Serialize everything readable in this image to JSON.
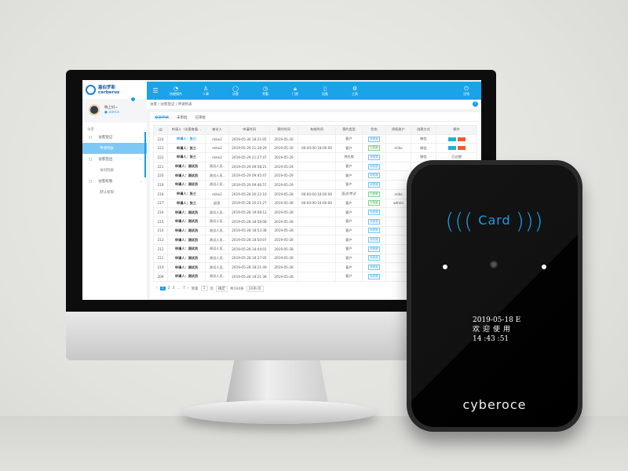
{
  "app": {
    "logo_cn": "塞伯罗斯",
    "logo_en": "cerberus"
  },
  "user": {
    "greeting": "晚上好~",
    "role": "admin"
  },
  "sidebar": {
    "group": "访客",
    "items": [
      {
        "label": "访客登记",
        "icon": "register-icon",
        "children": [
          {
            "label": "申请列表",
            "active": true
          }
        ]
      },
      {
        "label": "访客签出",
        "icon": "person-icon",
        "children": [
          {
            "label": "访问列表"
          }
        ]
      },
      {
        "label": "访客权限",
        "icon": "lock-icon",
        "children": [
          {
            "label": "默认权限"
          }
        ]
      }
    ]
  },
  "topnav": [
    {
      "label": "快捷操作",
      "icon": "dashboard-icon"
    },
    {
      "label": "人事",
      "icon": "person-icon"
    },
    {
      "label": "访客",
      "icon": "visitor-icon"
    },
    {
      "label": "考勤",
      "icon": "clock-icon"
    },
    {
      "label": "门禁",
      "icon": "lock-icon"
    },
    {
      "label": "设备",
      "icon": "device-icon"
    },
    {
      "label": "工具",
      "icon": "gear-icon"
    }
  ],
  "logout": "注销",
  "breadcrumb": [
    "访客",
    "访客登记",
    "申请列表"
  ],
  "tabs": [
    "全部申请",
    "未审批",
    "已审批"
  ],
  "table": {
    "headers": [
      "ID",
      "申请人（访客查看…",
      "被访人",
      "申请时间",
      "预约时间",
      "有效时间",
      "预约类型",
      "状态",
      "授权账户",
      "创建方式",
      "操作"
    ],
    "rows": [
      [
        "224",
        "申请人：张三",
        "mike2",
        "2019-05-30 18:21:05",
        "2019-05-30",
        "",
        "客户",
        "待批准",
        "",
        "微信",
        "actions"
      ],
      [
        "223",
        "申请人：张三",
        "mike2",
        "2019-05-29 21:28:29",
        "2019-05-30",
        "06:00:00-18:00:00",
        "客户",
        "已批准",
        "mike",
        "微信",
        "actions"
      ],
      [
        "222",
        "申请人：张三",
        "mike2",
        "2019-05-29 21:27:47",
        "2019-05-29",
        "",
        "供应商",
        "待批准",
        "",
        "微信",
        "已过期"
      ],
      [
        "221",
        "申请人：测试员",
        "测试人员..",
        "2019-05-29 09:58:21",
        "2019-05-29",
        "",
        "客户",
        "待批准",
        "",
        "",
        ""
      ],
      [
        "220",
        "申请人：测试员",
        "测试人员..",
        "2019-05-29 09:45:47",
        "2019-05-29",
        "",
        "客户",
        "待批准",
        "",
        "",
        ""
      ],
      [
        "219",
        "申请人：测试员",
        "测试人员..",
        "2019-05-29 09:46:57",
        "2019-05-29",
        "",
        "客户",
        "待批准",
        "",
        "",
        ""
      ],
      [
        "218",
        "申请人：张三",
        "mike2",
        "2019-05-28 20:22:10",
        "2019-05-28",
        "06:00:00-18:00:00",
        "面试/考试",
        "已批准",
        "mike",
        "",
        ""
      ],
      [
        "217",
        "申请人：张三",
        "赵凯",
        "2019-05-28 20:21:27",
        "2019-05-28",
        "06:00:00-18:00:00",
        "客户",
        "已批准",
        "admin",
        "",
        ""
      ],
      [
        "216",
        "申请人：测试员",
        "测试人员..",
        "2019-05-28 19:08:12",
        "2019-05-28",
        "",
        "客户",
        "待批准",
        "",
        "",
        ""
      ],
      [
        "215",
        "申请人：测试员",
        "测试人员..",
        "2019-05-28 18:59:08",
        "2019-05-28",
        "",
        "客户",
        "待批准",
        "",
        "",
        ""
      ],
      [
        "214",
        "申请人：测试员",
        "测试人员..",
        "2019-05-28 18:53:38",
        "2019-05-28",
        "",
        "客户",
        "待批准",
        "",
        "",
        ""
      ],
      [
        "213",
        "申请人：测试员",
        "测试人员..",
        "2019-05-28 18:50:07",
        "2019-05-28",
        "",
        "客户",
        "待批准",
        "",
        "",
        ""
      ],
      [
        "212",
        "申请人：测试员",
        "测试人员..",
        "2019-05-28 18:44:01",
        "2019-05-28",
        "",
        "客户",
        "待批准",
        "",
        "",
        ""
      ],
      [
        "211",
        "申请人：测试员",
        "测试人员..",
        "2019-05-28 18:27:05",
        "2019-05-28",
        "",
        "客户",
        "待批准",
        "",
        "",
        ""
      ],
      [
        "210",
        "申请人：测试员",
        "测试人员..",
        "2019-05-28 18:21:49",
        "2019-05-28",
        "",
        "客户",
        "待批准",
        "",
        "",
        ""
      ],
      [
        "209",
        "申请人：测试员",
        "测试人员..",
        "2019-05-28 18:21:38",
        "2019-05-28",
        "",
        "客户",
        "待批准",
        "",
        "",
        ""
      ]
    ],
    "action_buttons": [
      "编辑",
      "拒绝"
    ]
  },
  "pagination": {
    "pages": [
      "1",
      "2",
      "3",
      "…",
      "7"
    ],
    "goto_label": "到第",
    "page_value": "1",
    "page_unit": "页",
    "confirm": "确定",
    "total": "共104条",
    "page_size": "20条/页"
  },
  "colors": {
    "accent": "#1aa3e8",
    "edit": "#1fb1d6",
    "reject": "#f25a2b"
  },
  "reader": {
    "card_label": "Card",
    "display": {
      "date": "2019-05-18 E",
      "welcome": "欢迎使用",
      "time": "14 :43 :51"
    },
    "brand": "cyberoce"
  }
}
